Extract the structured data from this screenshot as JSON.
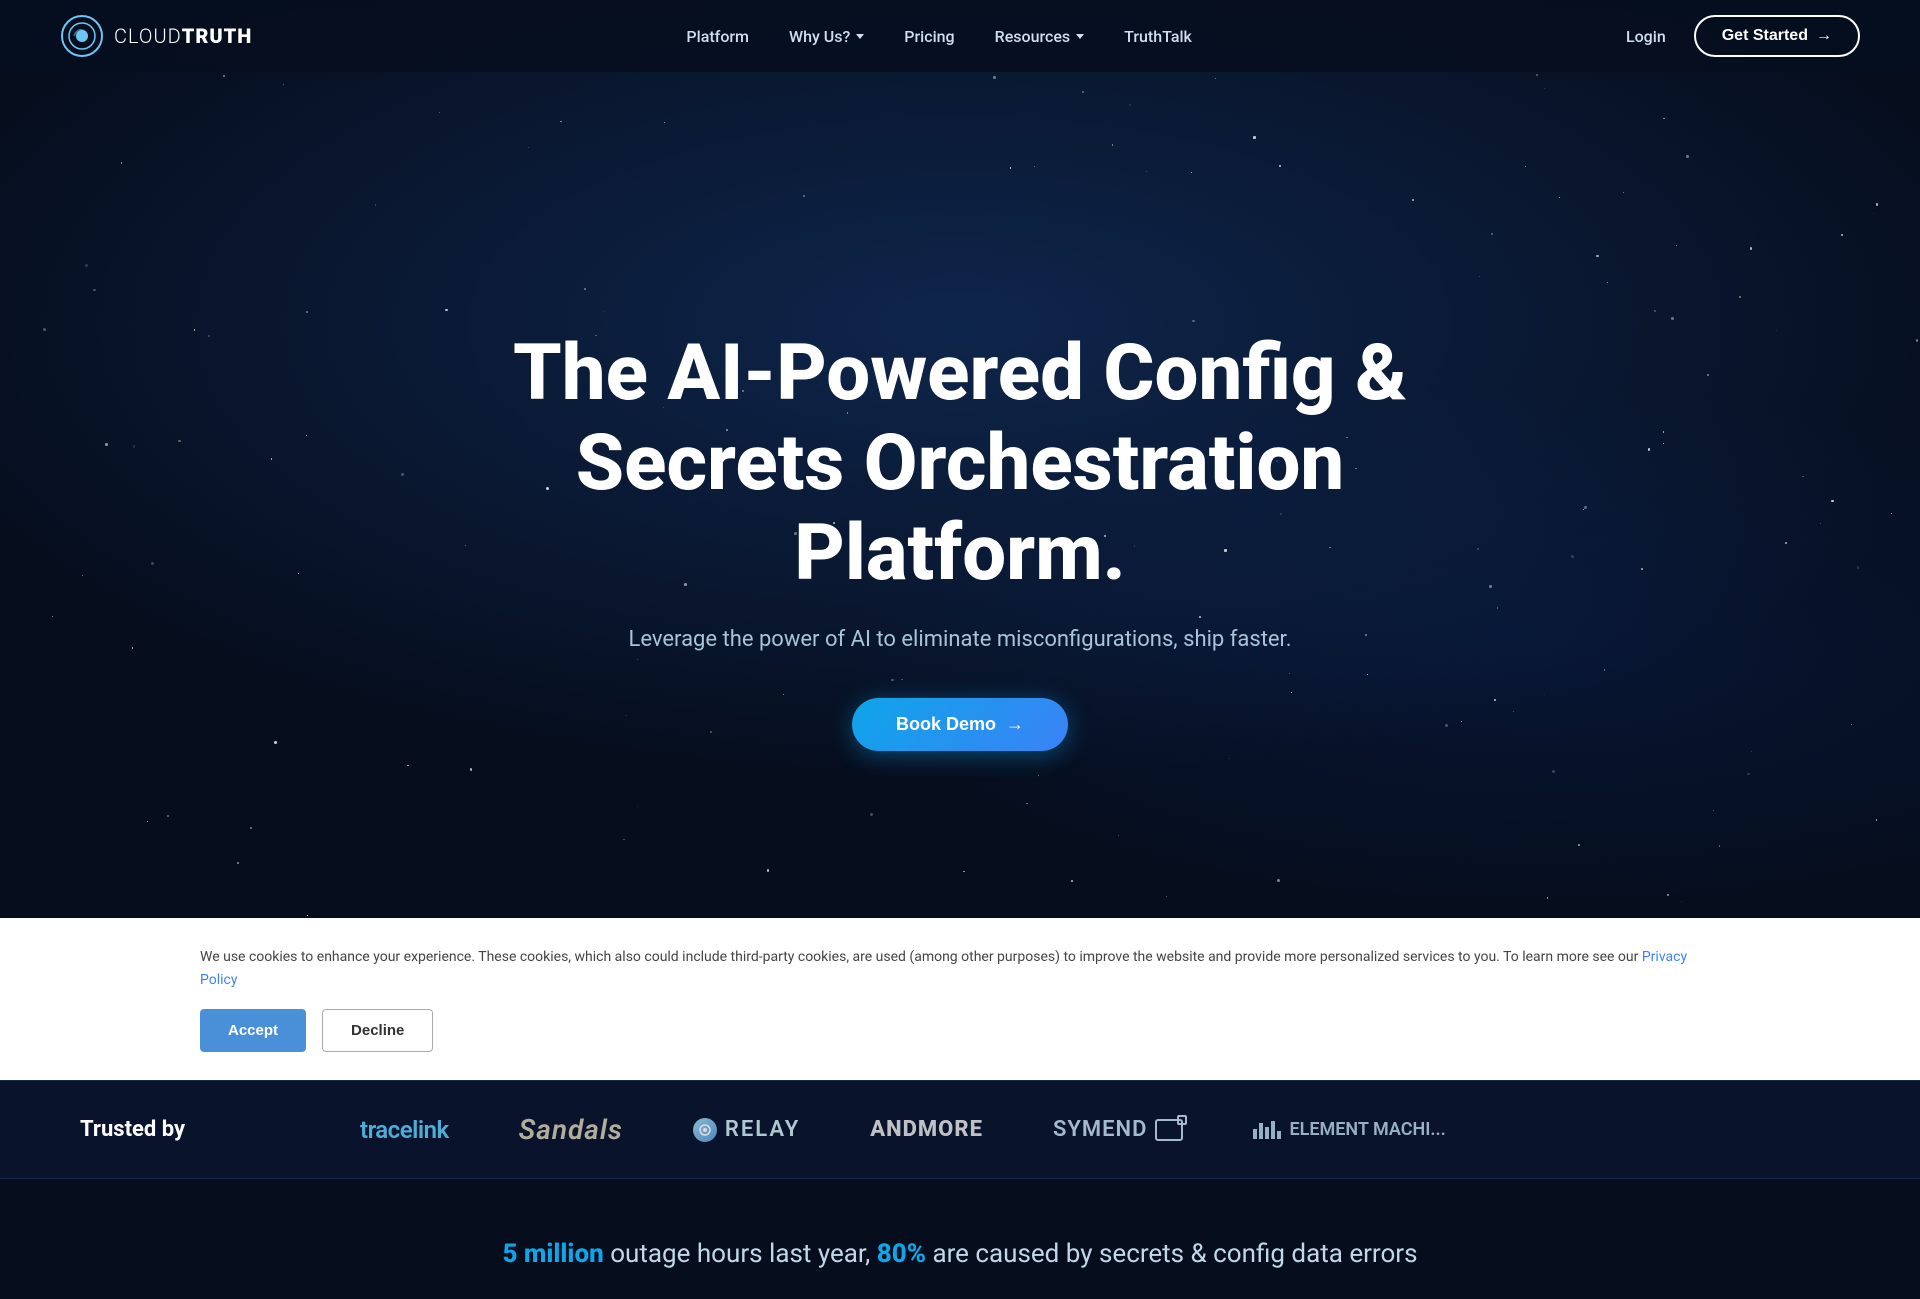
{
  "brand": {
    "name_light": "CLOUD",
    "name_bold": "TRUTH",
    "logo_alt": "CloudTruth Logo"
  },
  "nav": {
    "links": [
      {
        "id": "platform",
        "label": "Platform",
        "has_dropdown": false
      },
      {
        "id": "why-us",
        "label": "Why Us?",
        "has_dropdown": true
      },
      {
        "id": "pricing",
        "label": "Pricing",
        "has_dropdown": false
      },
      {
        "id": "resources",
        "label": "Resources",
        "has_dropdown": true
      },
      {
        "id": "truthtalk",
        "label": "TruthTalk",
        "has_dropdown": false
      }
    ],
    "login_label": "Login",
    "cta_label": "Get Started",
    "cta_arrow": "→"
  },
  "hero": {
    "title": "The AI-Powered Config & Secrets Orchestration Platform.",
    "subtitle": "Leverage the power of AI to eliminate misconfigurations, ship faster.",
    "cta_label": "Book Demo",
    "cta_arrow": "→"
  },
  "trusted": {
    "label": "Trusted by",
    "logos": [
      {
        "id": "tracelink",
        "text": "tracelink"
      },
      {
        "id": "sandals",
        "text": "Sandals"
      },
      {
        "id": "relay",
        "text": "RELAY"
      },
      {
        "id": "andmore",
        "text": "ANDMORE"
      },
      {
        "id": "symend",
        "text": "SYMEND"
      },
      {
        "id": "element",
        "name": "ELEMENT MACHI..."
      }
    ]
  },
  "stats": {
    "highlight1": "5 million",
    "text1": " outage hours last year, ",
    "highlight2": "80%",
    "text2": " are caused by secrets & config data errors"
  },
  "cookie": {
    "text": "We use cookies to enhance your experience. These cookies, which also could include third-party cookies, are used (among other purposes) to improve the website and provide more personalized services to you. To learn more see our ",
    "link_text": "Privacy Policy",
    "accept_label": "Accept",
    "decline_label": "Decline"
  }
}
